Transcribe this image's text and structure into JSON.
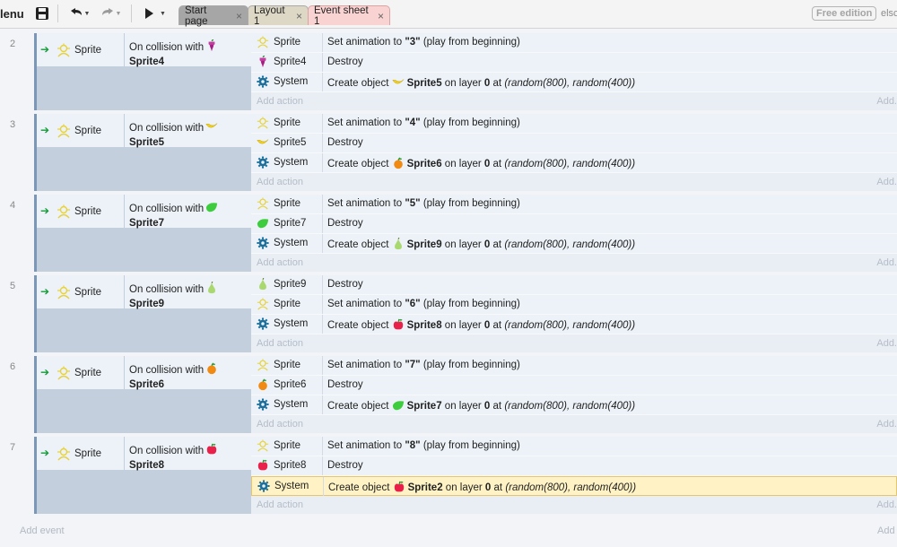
{
  "toolbar": {
    "menu_label": "lenu",
    "tabs": [
      {
        "label": "Start page",
        "close": "×"
      },
      {
        "label": "Layout 1",
        "close": "×"
      },
      {
        "label": "Event sheet 1",
        "close": "×"
      }
    ],
    "free_edition": "Free edition",
    "else_text": "elsc"
  },
  "events": [
    {
      "number": "2",
      "condition": {
        "object": "Sprite",
        "text": "On collision with",
        "target": "Sprite4",
        "target_icon": "grapes-icon"
      },
      "actions": [
        {
          "object": "Sprite",
          "icon": "sprite-outline-icon",
          "pre": "Set animation to ",
          "bold": "\"3\"",
          "post": " (play from beginning)"
        },
        {
          "object": "Sprite4",
          "icon": "grapes-icon",
          "pre": "Destroy"
        },
        {
          "object": "System",
          "icon": "gear-icon",
          "pre": "Create object ",
          "create_icon": "banana-icon",
          "bold": "Sprite5",
          "mid": " on layer ",
          "layer": "0",
          "after": " at ",
          "italic": "(random(800), random(400))"
        }
      ]
    },
    {
      "number": "3",
      "condition": {
        "object": "Sprite",
        "text": "On collision with",
        "target": "Sprite5",
        "target_icon": "banana-icon"
      },
      "actions": [
        {
          "object": "Sprite",
          "icon": "sprite-outline-icon",
          "pre": "Set animation to ",
          "bold": "\"4\"",
          "post": " (play from beginning)"
        },
        {
          "object": "Sprite5",
          "icon": "banana-icon",
          "pre": "Destroy"
        },
        {
          "object": "System",
          "icon": "gear-icon",
          "pre": "Create object ",
          "create_icon": "orange-icon",
          "bold": "Sprite6",
          "mid": " on layer ",
          "layer": "0",
          "after": " at ",
          "italic": "(random(800), random(400))"
        }
      ]
    },
    {
      "number": "4",
      "condition": {
        "object": "Sprite",
        "text": "On collision with",
        "target": "Sprite7",
        "target_icon": "lime-icon"
      },
      "actions": [
        {
          "object": "Sprite",
          "icon": "sprite-outline-icon",
          "pre": "Set animation to ",
          "bold": "\"5\"",
          "post": " (play from beginning)"
        },
        {
          "object": "Sprite7",
          "icon": "lime-icon",
          "pre": "Destroy"
        },
        {
          "object": "System",
          "icon": "gear-icon",
          "pre": "Create object ",
          "create_icon": "pear-icon",
          "bold": "Sprite9",
          "mid": " on layer ",
          "layer": "0",
          "after": " at ",
          "italic": "(random(800), random(400))"
        }
      ]
    },
    {
      "number": "5",
      "condition": {
        "object": "Sprite",
        "text": "On collision with",
        "target": "Sprite9",
        "target_icon": "pear-icon"
      },
      "actions": [
        {
          "object": "Sprite9",
          "icon": "pear-icon",
          "pre": "Destroy"
        },
        {
          "object": "Sprite",
          "icon": "sprite-outline-icon",
          "pre": "Set animation to ",
          "bold": "\"6\"",
          "post": " (play from beginning)"
        },
        {
          "object": "System",
          "icon": "gear-icon",
          "pre": "Create object ",
          "create_icon": "apple-icon",
          "bold": "Sprite8",
          "mid": " on layer ",
          "layer": "0",
          "after": " at ",
          "italic": "(random(800), random(400))"
        }
      ]
    },
    {
      "number": "6",
      "condition": {
        "object": "Sprite",
        "text": "On collision with",
        "target": "Sprite6",
        "target_icon": "orange-icon"
      },
      "actions": [
        {
          "object": "Sprite",
          "icon": "sprite-outline-icon",
          "pre": "Set animation to ",
          "bold": "\"7\"",
          "post": " (play from beginning)"
        },
        {
          "object": "Sprite6",
          "icon": "orange-icon",
          "pre": "Destroy"
        },
        {
          "object": "System",
          "icon": "gear-icon",
          "pre": "Create object ",
          "create_icon": "lime-icon",
          "bold": "Sprite7",
          "mid": " on layer ",
          "layer": "0",
          "after": " at ",
          "italic": "(random(800), random(400))"
        }
      ]
    },
    {
      "number": "7",
      "condition": {
        "object": "Sprite",
        "text": "On collision with",
        "target": "Sprite8",
        "target_icon": "apple-icon"
      },
      "actions": [
        {
          "object": "Sprite",
          "icon": "sprite-outline-icon",
          "pre": "Set animation to ",
          "bold": "\"8\"",
          "post": " (play from beginning)"
        },
        {
          "object": "Sprite8",
          "icon": "apple-icon",
          "pre": "Destroy"
        },
        {
          "object": "System",
          "icon": "gear-icon",
          "pre": "Create object ",
          "create_icon": "apple-icon",
          "bold": "Sprite2",
          "mid": " on layer ",
          "layer": "0",
          "after": " at ",
          "italic": "(random(800), random(400))",
          "selected": true
        }
      ]
    }
  ],
  "add_action_label": "Add action",
  "add_right_label": "Add.",
  "add_event_label": "Add event",
  "add_event_right": "Add",
  "colors": {
    "selected_row": "#fff2c4",
    "condition_bg": "#ecf2f8",
    "event_bar": "#7b97b7",
    "arrow_green": "#169a3a"
  }
}
